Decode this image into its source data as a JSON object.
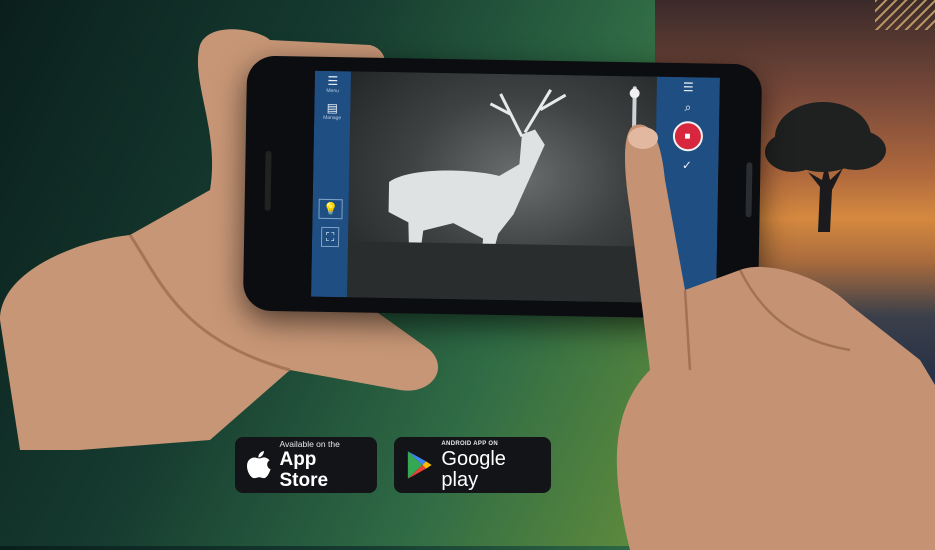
{
  "badges": {
    "app_store": {
      "small": "Available on the",
      "big": "App Store"
    },
    "google_play": {
      "small": "ANDROID APP ON",
      "big": "Google play"
    }
  },
  "app": {
    "left_panel": [
      {
        "label": "Menu",
        "icon": "hamburger-icon"
      },
      {
        "label": "Manage",
        "icon": "film-icon"
      },
      {
        "label": "",
        "icon": "lightbulb-icon"
      },
      {
        "label": "",
        "icon": "fullscreen-icon"
      }
    ],
    "right_panel": [
      {
        "label": "",
        "icon": "hamburger-icon"
      },
      {
        "label": "",
        "icon": "zoom-icon"
      },
      {
        "label": "",
        "icon": "record-icon"
      },
      {
        "label": "",
        "icon": "check-icon"
      }
    ]
  },
  "colors": {
    "panel_blue": "#1f4e82",
    "record_red": "#d7263d"
  }
}
